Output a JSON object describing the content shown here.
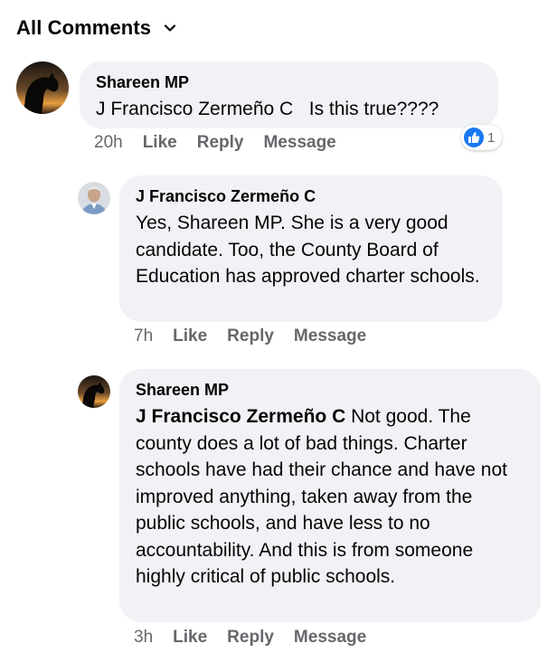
{
  "header": {
    "title": "All Comments"
  },
  "comments": [
    {
      "author": "Shareen MP",
      "mention": "J Francisco Zermeño C",
      "text": "Is this true????",
      "time": "20h",
      "actions": [
        "Like",
        "Reply",
        "Message"
      ],
      "reaction_count": "1"
    },
    {
      "author": "J Francisco Zermeño C",
      "text": "Yes, Shareen MP. She is a very good candidate. Too, the County Board of Education has approved charter schools.",
      "time": "7h",
      "actions": [
        "Like",
        "Reply",
        "Message"
      ]
    },
    {
      "author": "Shareen MP",
      "mention": "J Francisco Zermeño C",
      "text": " Not good. The county does a lot of bad things. Charter schools have had their chance and have not improved anything, taken away from the public schools, and have less to no accountability. And this is from someone highly critical of public schools.",
      "time": "3h",
      "actions": [
        "Like",
        "Reply",
        "Message"
      ]
    }
  ],
  "colors": {
    "bubble": "#f0f2f5",
    "meta": "#65676b",
    "like_blue": "#1877f2"
  }
}
